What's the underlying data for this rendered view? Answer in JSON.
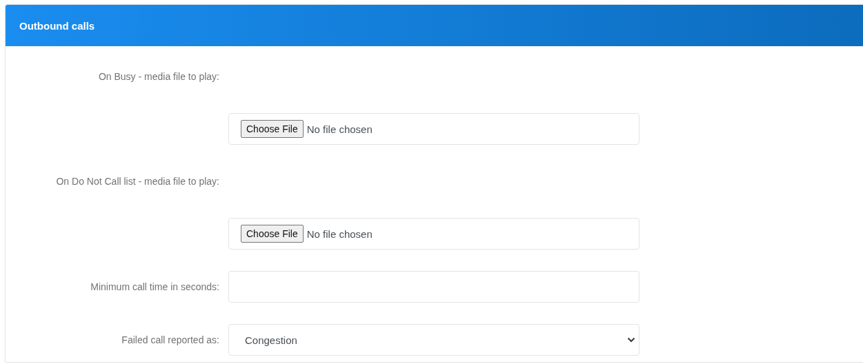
{
  "panel": {
    "title": "Outbound calls"
  },
  "fields": [
    {
      "kind": "file",
      "label": "On Busy - media file to play:",
      "button": "Choose File",
      "status": "No file chosen"
    },
    {
      "kind": "file",
      "label": "On Do Not Call list - media file to play:",
      "button": "Choose File",
      "status": "No file chosen"
    },
    {
      "kind": "text",
      "label": "Minimum call time in seconds:"
    },
    {
      "kind": "select",
      "label": "Failed call reported as:",
      "value": "Congestion"
    }
  ]
}
